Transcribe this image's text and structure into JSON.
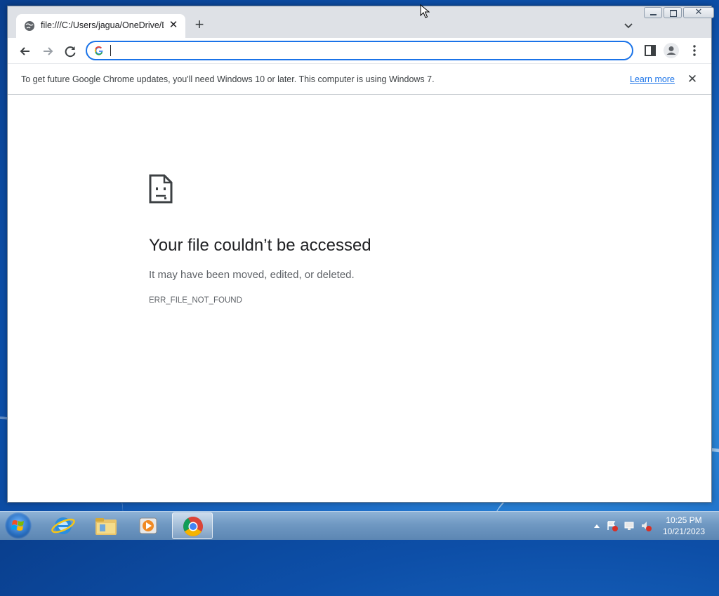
{
  "browser": {
    "tab": {
      "title": "file:///C:/Users/jagua/OneDrive/Documents",
      "close_glyph": "✕"
    },
    "new_tab_glyph": "+",
    "omnibox": {
      "value": "",
      "placeholder": ""
    },
    "window_controls": {
      "close_glyph": "✕"
    }
  },
  "infobar": {
    "message": "To get future Google Chrome updates, you'll need Windows 10 or later. This computer is using Windows 7.",
    "link": "Learn more",
    "close_glyph": "✕"
  },
  "error_page": {
    "title": "Your file couldn’t be accessed",
    "subtitle": "It may have been moved, edited, or deleted.",
    "code": "ERR_FILE_NOT_FOUND"
  },
  "taskbar": {
    "items": [
      "internet-explorer-icon",
      "file-explorer-icon",
      "media-player-icon",
      "chrome-icon"
    ],
    "active_item": "chrome-icon",
    "clock": {
      "time": "10:25 PM",
      "date": "10/21/2023"
    }
  },
  "colors": {
    "accent": "#1a73e8",
    "tabstrip": "#dee1e6",
    "desktop": "#1e6fc9"
  }
}
